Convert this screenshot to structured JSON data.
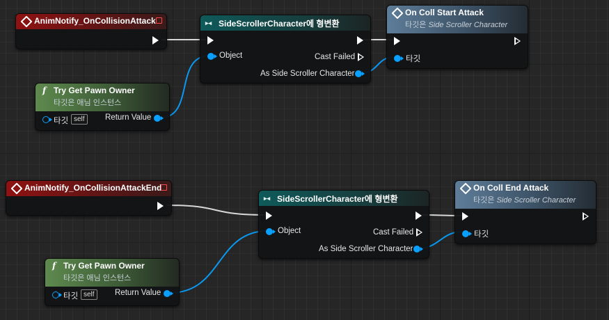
{
  "graph_a": {
    "event": {
      "title": "AnimNotify_OnCollisionAttack"
    },
    "cast": {
      "title": "SideScrollerCharacter에 형변환",
      "object_label": "Object",
      "cast_failed_label": "Cast Failed",
      "as_label": "As Side Scroller Character"
    },
    "call": {
      "title": "On Coll Start Attack",
      "target_prefix": "타깃은",
      "target_class": "Side Scroller Character",
      "target_pin_label": "타깃"
    },
    "pawn": {
      "title": "Try Get Pawn Owner",
      "subtitle": "타깃은 애님 인스턴스",
      "target_label": "타깃",
      "self_label": "self",
      "return_label": "Return Value"
    }
  },
  "graph_b": {
    "event": {
      "title": "AnimNotify_OnCollisionAttackEnd"
    },
    "cast": {
      "title": "SideScrollerCharacter에 형변환",
      "object_label": "Object",
      "cast_failed_label": "Cast Failed",
      "as_label": "As Side Scroller Character"
    },
    "call": {
      "title": "On Coll End Attack",
      "target_prefix": "타깃은",
      "target_class": "Side Scroller Character",
      "target_pin_label": "타깃"
    },
    "pawn": {
      "title": "Try Get Pawn Owner",
      "subtitle": "타깃은 애님 인스턴스",
      "target_label": "타깃",
      "self_label": "self",
      "return_label": "Return Value"
    }
  },
  "colors": {
    "event_header": "#8f1212",
    "cast_header": "#0f5a5a",
    "function_header": "#5e7d99",
    "pure_function_header": "#5e8a4e",
    "object_pin": "#0aa0ff",
    "exec_wire": "#ffffff"
  },
  "icons": {
    "event": "event-diamond-icon",
    "cast": "cast-arrows-icon",
    "function": "function-f-icon",
    "delegate": "delegate-square-icon"
  }
}
